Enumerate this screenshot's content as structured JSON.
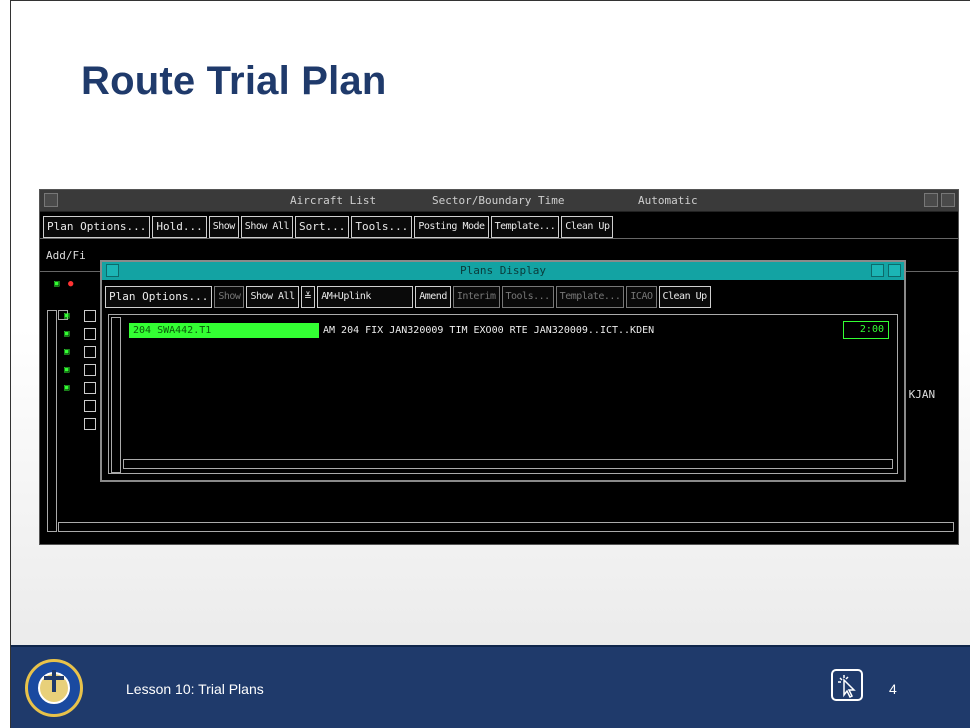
{
  "slide": {
    "title": "Route Trial Plan",
    "footer_lesson": "Lesson 10: Trial Plans",
    "page_number": "4"
  },
  "aircraft_list": {
    "title_items": [
      "Aircraft List",
      "Sector/Boundary Time",
      "Automatic"
    ],
    "toolbar": [
      "Plan Options...",
      "Hold...",
      "Show",
      "Show All",
      "Sort...",
      "Tools...",
      "Posting Mode",
      "Template...",
      "Clean Up"
    ],
    "row2_label": "Add/Fi",
    "right_text": ".KJAN"
  },
  "plans_display": {
    "title": "Plans Display",
    "toolbar": [
      {
        "label": "Plan Options...",
        "dim": false
      },
      {
        "label": "Show",
        "dim": true
      },
      {
        "label": "Show All",
        "dim": false
      },
      {
        "label": "≚",
        "dim": false
      },
      {
        "label": "AM+Uplink",
        "dim": false
      },
      {
        "label": "Amend",
        "dim": false
      },
      {
        "label": "Interim",
        "dim": true
      },
      {
        "label": "Tools...",
        "dim": true
      },
      {
        "label": "Template...",
        "dim": true
      },
      {
        "label": "ICAO",
        "dim": true
      },
      {
        "label": "Clean Up",
        "dim": false
      }
    ],
    "row": {
      "id": "204 SWA442.T1",
      "text": "AM 204 FIX JAN320009 TIM EXO00 RTE JAN320009..ICT..KDEN",
      "time": "2:00"
    }
  },
  "colors": {
    "title_blue": "#1f3a6b",
    "footer_blue": "#1f3a6b",
    "plans_titlebar": "#13a3a3",
    "highlight_green": "#33ff33"
  },
  "icons": {
    "footer_seal": "faa-seal-icon",
    "footer_click": "cursor-click-icon"
  }
}
